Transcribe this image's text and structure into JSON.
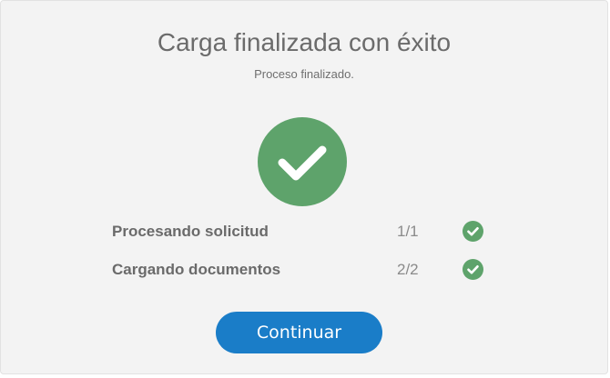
{
  "dialog": {
    "title": "Carga finalizada con éxito",
    "subtitle": "Proceso finalizado.",
    "status_icon": "check-circle-icon",
    "steps": [
      {
        "label": "Procesando solicitud",
        "count": "1/1",
        "status_icon": "check-circle-icon"
      },
      {
        "label": "Cargando documentos",
        "count": "2/2",
        "status_icon": "check-circle-icon"
      }
    ],
    "continue_label": "Continuar"
  },
  "colors": {
    "success": "#5ea36b",
    "primary": "#1a7dc8",
    "background": "#f3f3f3",
    "title_text": "#6b6b6b"
  }
}
